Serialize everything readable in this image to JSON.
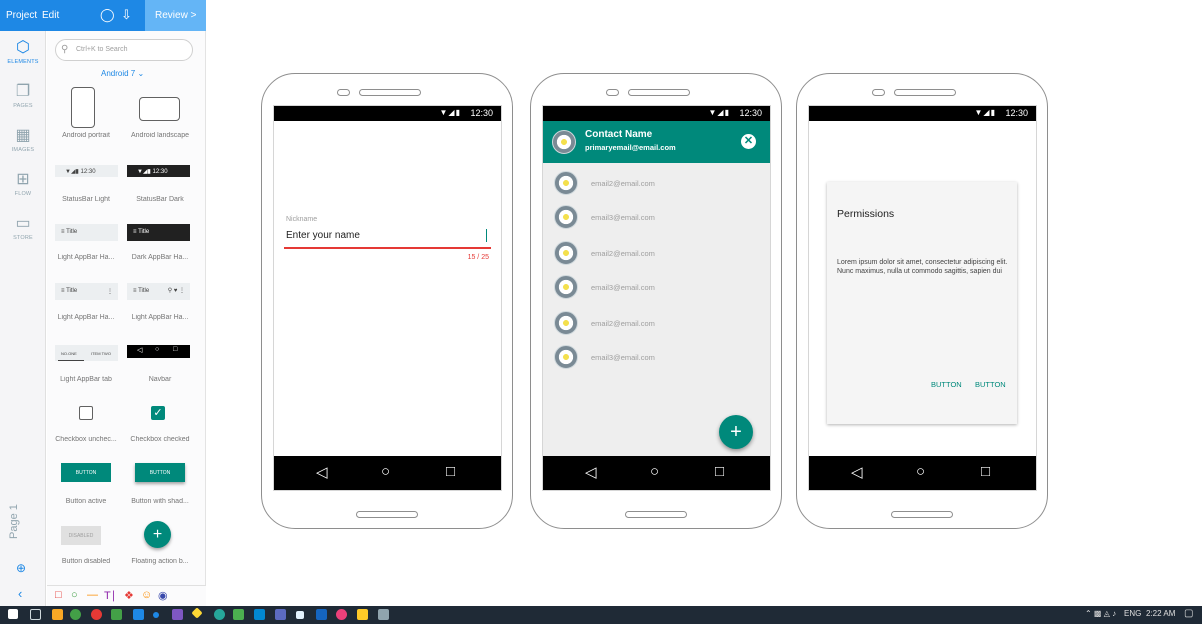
{
  "topbar": {
    "project": "Project",
    "edit": "Edit",
    "review": "Review >"
  },
  "rail": {
    "elements": "ELEMENTS",
    "pages": "PAGES",
    "images": "IMAGES",
    "flow": "FLOW",
    "store": "STORE",
    "page_label": "Page 1"
  },
  "library": {
    "search_placeholder": "Ctrl+K to Search",
    "version": "Android 7",
    "items": {
      "android_portrait": "Android portrait",
      "android_landscape": "Android landscape",
      "statusbar_light": "StatusBar Light",
      "statusbar_dark": "StatusBar Dark",
      "light_appbar_1": "Light AppBar Ha...",
      "dark_appbar": "Dark AppBar Ha...",
      "light_appbar_2": "Light AppBar Ha...",
      "light_appbar_3": "Light AppBar Ha...",
      "light_appbar_tab": "Light AppBar tab",
      "navbar": "Navbar",
      "checkbox_unchecked": "Checkbox unchec...",
      "checkbox_checked": "Checkbox checked",
      "button_active": "Button active",
      "button_shadow": "Button with shad...",
      "button_disabled": "Button disabled",
      "fab": "Floating action b..."
    },
    "thumbs": {
      "statusbar_time": "12:30",
      "appbar_title": "Title",
      "tab_one": "NO.ONE",
      "tab_two": "ITEM TWO",
      "button_text": "BUTTON",
      "disabled_text": "DISABLED"
    }
  },
  "status_time": "12:30",
  "phone1": {
    "nickname_label": "Nickname",
    "input_value": "Enter your name",
    "counter": "15 / 25"
  },
  "phone2": {
    "contact_name": "Contact Name",
    "primary_email": "primaryemail@email.com",
    "emails": [
      "email2@email.com",
      "email3@email.com",
      "email2@email.com",
      "email3@email.com",
      "email2@email.com",
      "email3@email.com"
    ]
  },
  "phone3": {
    "title": "Permissions",
    "body": "Lorem ipsum dolor sit amet, consectetur adipiscing elit. Nunc maximus, nulla ut commodo sagittis, sapien dui",
    "button1": "BUTTON",
    "button2": "BUTTON"
  },
  "taskbar": {
    "lang": "ENG",
    "time": "2:22 AM"
  },
  "colors": {
    "accent": "#1e88e5",
    "teal": "#00897b",
    "error": "#e53935"
  }
}
